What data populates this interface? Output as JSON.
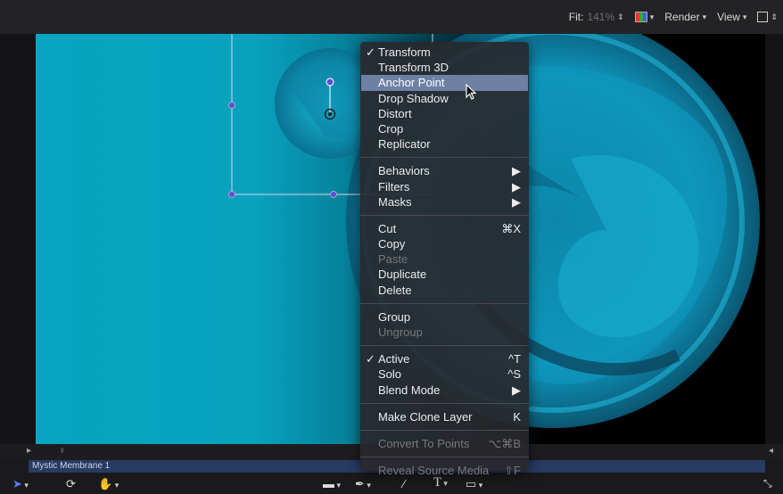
{
  "topbar": {
    "fit_label": "Fit:",
    "fit_value": "141%",
    "render_label": "Render",
    "view_label": "View"
  },
  "timeline": {
    "layer_name": "Mystic Membrane 1"
  },
  "context_menu": {
    "items": [
      {
        "label": "Transform",
        "checked": "✓"
      },
      {
        "label": "Transform 3D"
      },
      {
        "label": "Anchor Point"
      },
      {
        "label": "Drop Shadow"
      },
      {
        "label": "Distort"
      },
      {
        "label": "Crop"
      },
      {
        "label": "Replicator"
      },
      {
        "label": "Behaviors",
        "submenu": "▶"
      },
      {
        "label": "Filters",
        "submenu": "▶"
      },
      {
        "label": "Masks",
        "submenu": "▶"
      },
      {
        "label": "Cut",
        "shortcut": "⌘X"
      },
      {
        "label": "Copy"
      },
      {
        "label": "Paste"
      },
      {
        "label": "Duplicate"
      },
      {
        "label": "Delete"
      },
      {
        "label": "Group"
      },
      {
        "label": "Ungroup"
      },
      {
        "label": "Active",
        "checked": "✓",
        "shortcut": "^T"
      },
      {
        "label": "Solo",
        "shortcut": "^S"
      },
      {
        "label": "Blend Mode",
        "submenu": "▶"
      },
      {
        "label": "Make Clone Layer",
        "shortcut": "K"
      },
      {
        "label": "Convert To Points",
        "shortcut": "⌥⌘B"
      },
      {
        "label": "Reveal Source Media",
        "shortcut": "⇧F"
      }
    ]
  },
  "colors": {
    "accent_highlight": "#6e80a4",
    "canvas_cyan": "#07a5c1",
    "layer_bar": "#273b63",
    "handle": "#5b4fd6"
  }
}
